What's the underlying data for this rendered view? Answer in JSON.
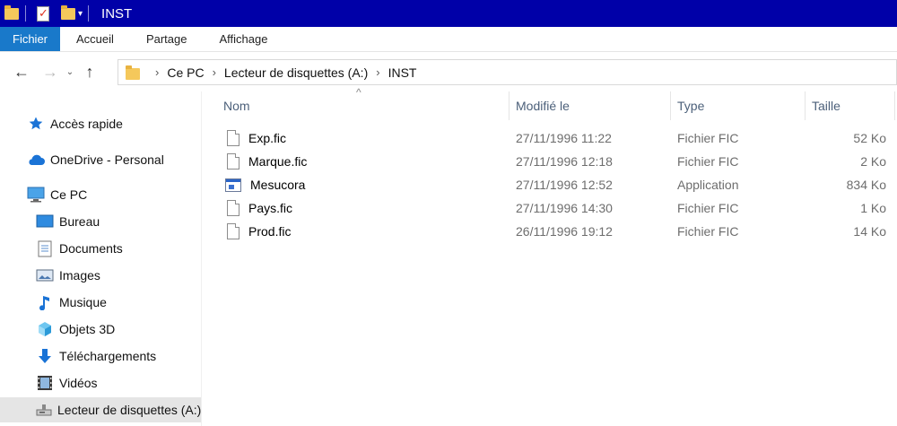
{
  "window": {
    "title": "INST"
  },
  "ribbon": {
    "tabs": [
      "Fichier",
      "Accueil",
      "Partage",
      "Affichage"
    ]
  },
  "address": {
    "crumbs": [
      "Ce PC",
      "Lecteur de disquettes (A:)",
      "INST"
    ]
  },
  "sidebar": {
    "items": [
      {
        "label": "Accès rapide",
        "icon": "star-icon"
      },
      {
        "label": "OneDrive - Personal",
        "icon": "cloud-icon"
      },
      {
        "label": "Ce PC",
        "icon": "computer-icon"
      },
      {
        "label": "Bureau",
        "icon": "desktop-icon"
      },
      {
        "label": "Documents",
        "icon": "documents-icon"
      },
      {
        "label": "Images",
        "icon": "pictures-icon"
      },
      {
        "label": "Musique",
        "icon": "music-icon"
      },
      {
        "label": "Objets 3D",
        "icon": "cube-icon"
      },
      {
        "label": "Téléchargements",
        "icon": "download-icon"
      },
      {
        "label": "Vidéos",
        "icon": "video-icon"
      },
      {
        "label": "Lecteur de disquettes (A:)",
        "icon": "floppy-drive-icon"
      }
    ]
  },
  "columns": {
    "name": "Nom",
    "modified": "Modifié le",
    "type": "Type",
    "size": "Taille"
  },
  "files": [
    {
      "name": "Exp.fic",
      "modified": "27/11/1996 11:22",
      "type": "Fichier FIC",
      "size": "52 Ko",
      "icon": "file-icon"
    },
    {
      "name": "Marque.fic",
      "modified": "27/11/1996 12:18",
      "type": "Fichier FIC",
      "size": "2 Ko",
      "icon": "file-icon"
    },
    {
      "name": "Mesucora",
      "modified": "27/11/1996 12:52",
      "type": "Application",
      "size": "834 Ko",
      "icon": "application-icon"
    },
    {
      "name": "Pays.fic",
      "modified": "27/11/1996 14:30",
      "type": "Fichier FIC",
      "size": "1 Ko",
      "icon": "file-icon"
    },
    {
      "name": "Prod.fic",
      "modified": "26/11/1996 19:12",
      "type": "Fichier FIC",
      "size": "14 Ko",
      "icon": "file-icon"
    }
  ]
}
